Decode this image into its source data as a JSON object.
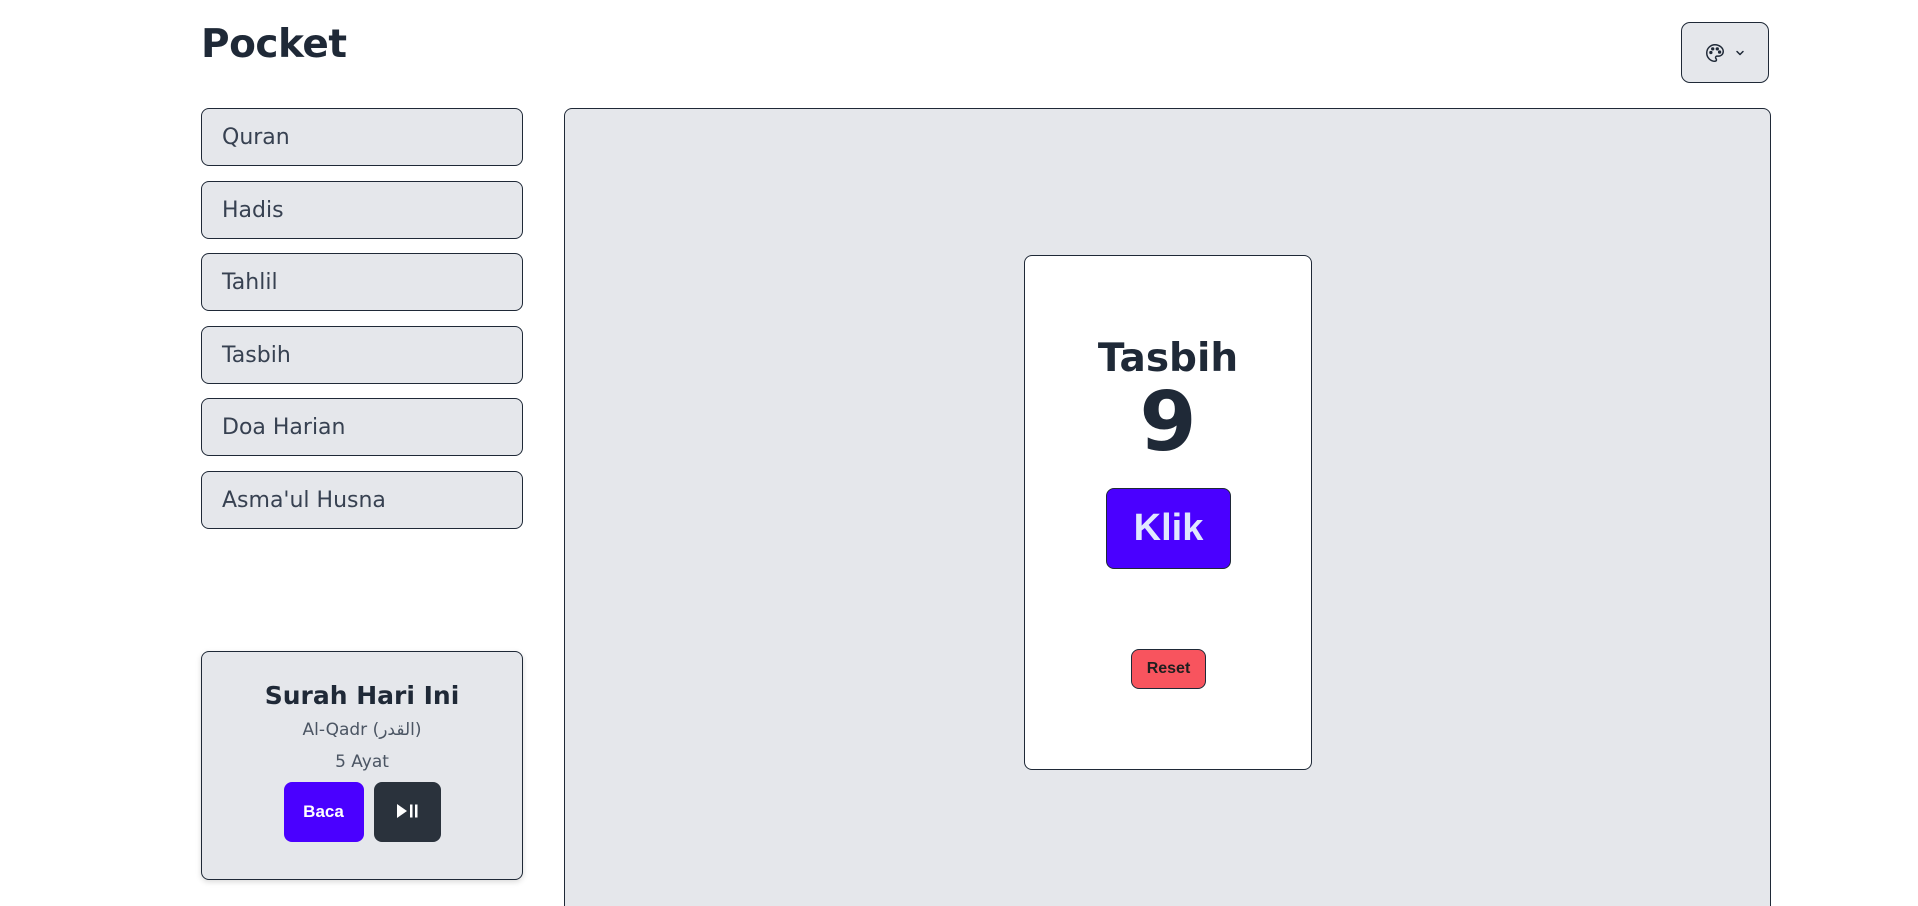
{
  "app": {
    "title": "Pocket"
  },
  "theme_button": {
    "icon": "palette-icon",
    "dropdown_icon": "chevron-down-icon"
  },
  "sidebar": {
    "items": [
      {
        "label": "Quran"
      },
      {
        "label": "Hadis"
      },
      {
        "label": "Tahlil"
      },
      {
        "label": "Tasbih"
      },
      {
        "label": "Doa Harian"
      },
      {
        "label": "Asma'ul Husna"
      }
    ]
  },
  "surah_card": {
    "title": "Surah Hari Ini",
    "name": "Al-Qadr (القدر)",
    "ayat": "5 Ayat",
    "read_label": "Baca",
    "play_icon": "play-pause-icon"
  },
  "tasbih": {
    "title": "Tasbih",
    "count": "9",
    "click_label": "Klik",
    "reset_label": "Reset"
  },
  "colors": {
    "primary": "#4a00ff",
    "neutral": "#2a323c",
    "error": "#f8545e",
    "panel": "#e5e7eb"
  }
}
